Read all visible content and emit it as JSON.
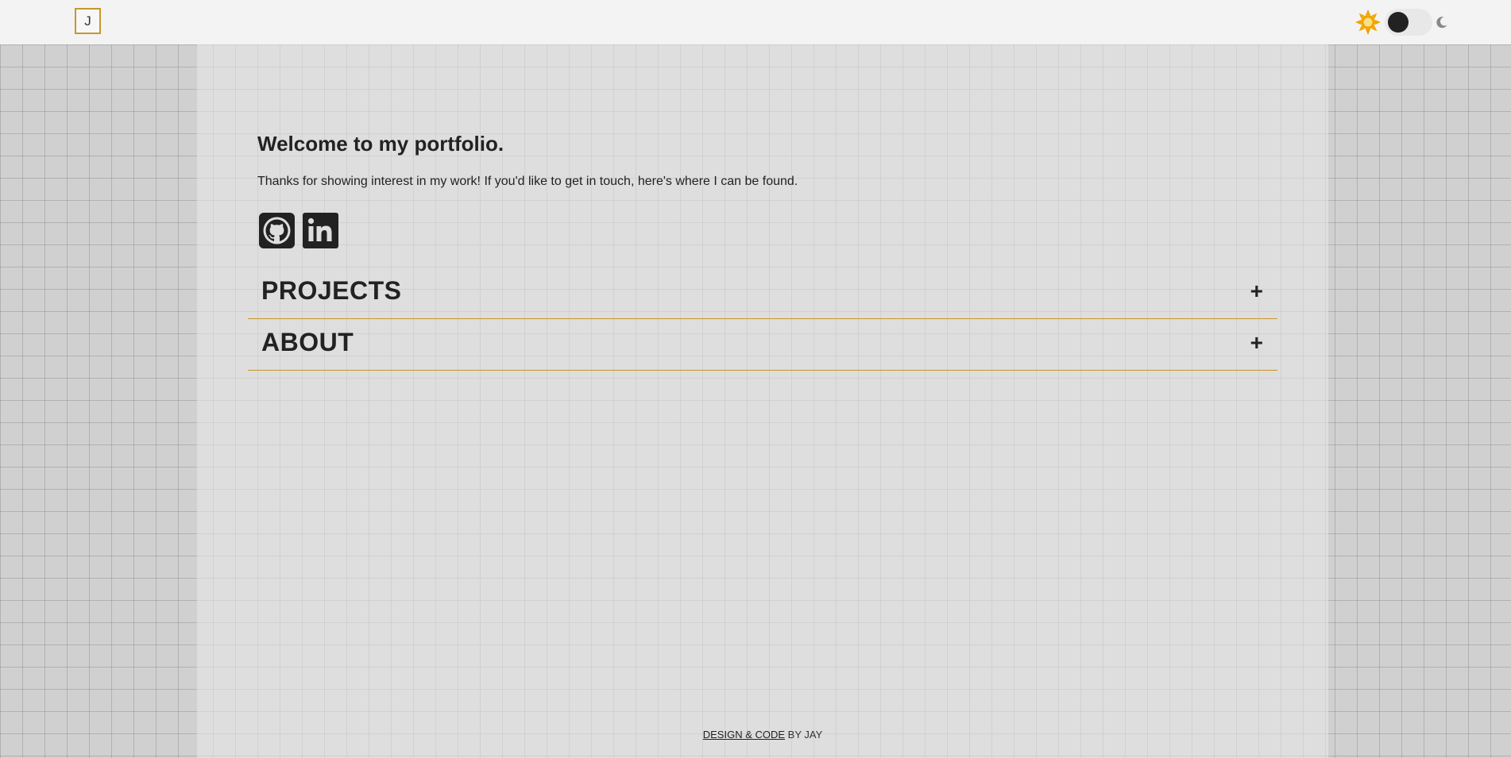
{
  "nav": {
    "logo_text": "J",
    "theme": {
      "sun_icon": "sun-icon",
      "moon_icon": "moon-icon",
      "mode": "light",
      "accent": "#f0a500"
    }
  },
  "main": {
    "title": "Welcome to my portfolio.",
    "intro": "Thanks for showing interest in my work! If you'd like to get in touch, here's where I can be found.",
    "social": [
      {
        "icon": "github-icon"
      },
      {
        "icon": "linkedin-icon"
      }
    ],
    "sections": [
      {
        "label": "PROJECTS",
        "toggle": "+"
      },
      {
        "label": "ABOUT",
        "toggle": "+"
      }
    ]
  },
  "footer": {
    "link_text": "DESIGN & CODE",
    "suffix": " BY JAY"
  },
  "colors": {
    "accent_border": "#c8962a",
    "navbar_bg": "#f3f3f3",
    "panel_bg": "#dedede",
    "text": "#222222"
  }
}
